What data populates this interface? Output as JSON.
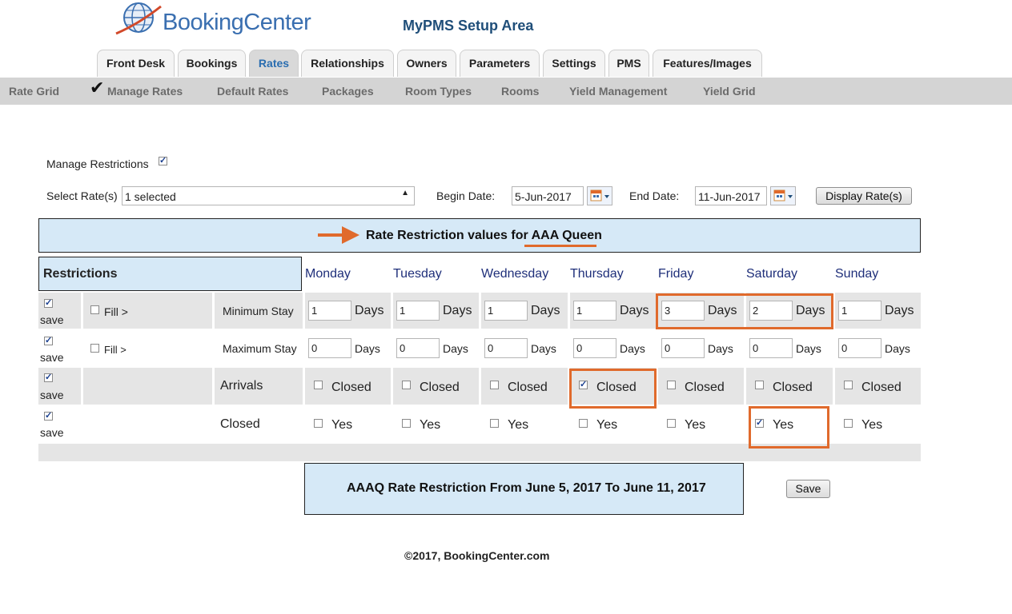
{
  "brand": {
    "logo_text": "BookingCenter",
    "app_title": "MyPMS Setup Area"
  },
  "tabs": [
    {
      "label": "Front Desk",
      "active": false
    },
    {
      "label": "Bookings",
      "active": false
    },
    {
      "label": "Rates",
      "active": true
    },
    {
      "label": "Relationships",
      "active": false
    },
    {
      "label": "Owners",
      "active": false
    },
    {
      "label": "Parameters",
      "active": false
    },
    {
      "label": "Settings",
      "active": false
    },
    {
      "label": "PMS",
      "active": false
    },
    {
      "label": "Features/Images",
      "active": false
    }
  ],
  "subnav": [
    {
      "label": "Rate Grid",
      "checked": false
    },
    {
      "label": "Manage Rates",
      "checked": true
    },
    {
      "label": "Default Rates",
      "checked": false
    },
    {
      "label": "Packages",
      "checked": false
    },
    {
      "label": "Room Types",
      "checked": false
    },
    {
      "label": "Rooms",
      "checked": false
    },
    {
      "label": "Yield Management",
      "checked": false
    },
    {
      "label": "Yield Grid",
      "checked": false
    }
  ],
  "form": {
    "manage_restrictions_label": "Manage Restrictions",
    "manage_restrictions_checked": true,
    "select_rates_label": "Select Rate(s)",
    "select_rates_value": "1 selected",
    "begin_date_label": "Begin Date:",
    "begin_date_value": "5-Jun-2017",
    "end_date_label": "End Date:",
    "end_date_value": "11-Jun-2017",
    "display_button": "Display Rate(s)"
  },
  "banner": {
    "prefix": "Rate Restriction values for ",
    "rate_name": "AAA Queen"
  },
  "grid": {
    "header": "Restrictions",
    "days": [
      "Monday",
      "Tuesday",
      "Wednesday",
      "Thursday",
      "Friday",
      "Saturday",
      "Sunday"
    ],
    "save_label": "save",
    "fill_label": "Fill >",
    "days_unit": "Days",
    "rows": {
      "min_stay": {
        "label": "Minimum Stay",
        "values": [
          "1",
          "1",
          "1",
          "1",
          "3",
          "2",
          "1"
        ]
      },
      "max_stay": {
        "label": "Maximum Stay",
        "values": [
          "0",
          "0",
          "0",
          "0",
          "0",
          "0",
          "0"
        ]
      },
      "arrivals": {
        "label": "Arrivals",
        "option": "Closed",
        "checked": [
          false,
          false,
          false,
          true,
          false,
          false,
          false
        ]
      },
      "closed": {
        "label": "Closed",
        "option": "Yes",
        "checked": [
          false,
          false,
          false,
          false,
          false,
          true,
          false
        ]
      }
    }
  },
  "summary": "AAAQ Rate Restriction From June 5, 2017 To June 11, 2017",
  "save_button": "Save",
  "copyright": "©2017, BookingCenter.com",
  "colors": {
    "accent": "#e06a2c",
    "panel": "#d6e9f7",
    "nav": "#d4d4d4",
    "link": "#1f4e79"
  }
}
